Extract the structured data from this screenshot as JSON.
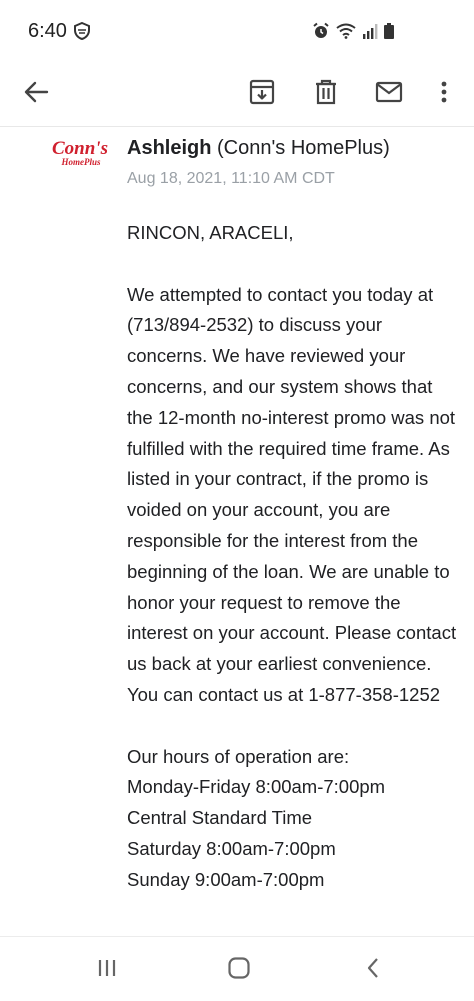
{
  "status": {
    "time": "6:40"
  },
  "toolbar": {
    "icons": [
      "back-arrow-icon",
      "archive-icon",
      "delete-icon",
      "mark-unread-icon",
      "more-vert-icon"
    ]
  },
  "email": {
    "logo_text": "Conn's",
    "logo_sub": "HomePlus",
    "sender_name": "Ashleigh",
    "sender_org": "(Conn's HomePlus)",
    "date": "Aug 18, 2021, 11:10 AM CDT",
    "greeting": "RINCON, ARACELI,",
    "paragraph_1": "We attempted to contact you today at (713/894-2532) to discuss your concerns. We have reviewed your concerns, and our system shows that the 12-month no-interest promo was not fulfilled with the required time frame. As listed in your contract, if the promo is voided on your account, you are responsible for the interest from the beginning of the loan. We are unable to honor your request to remove the interest on your account. Please contact us back at your earliest convenience. You can contact us at 1-877-358-1252",
    "hours_title": "Our hours of operation are:",
    "hours_line_1": "Monday-Friday 8:00am-7:00pm",
    "hours_line_2": "Central Standard Time",
    "hours_line_3": "Saturday 8:00am-7:00pm",
    "hours_line_4": "Sunday 9:00am-7:00pm"
  },
  "colors": {
    "logo_red": "#d0202e",
    "date_gray": "#9aa0a6",
    "icon_gray": "#5f6368"
  }
}
